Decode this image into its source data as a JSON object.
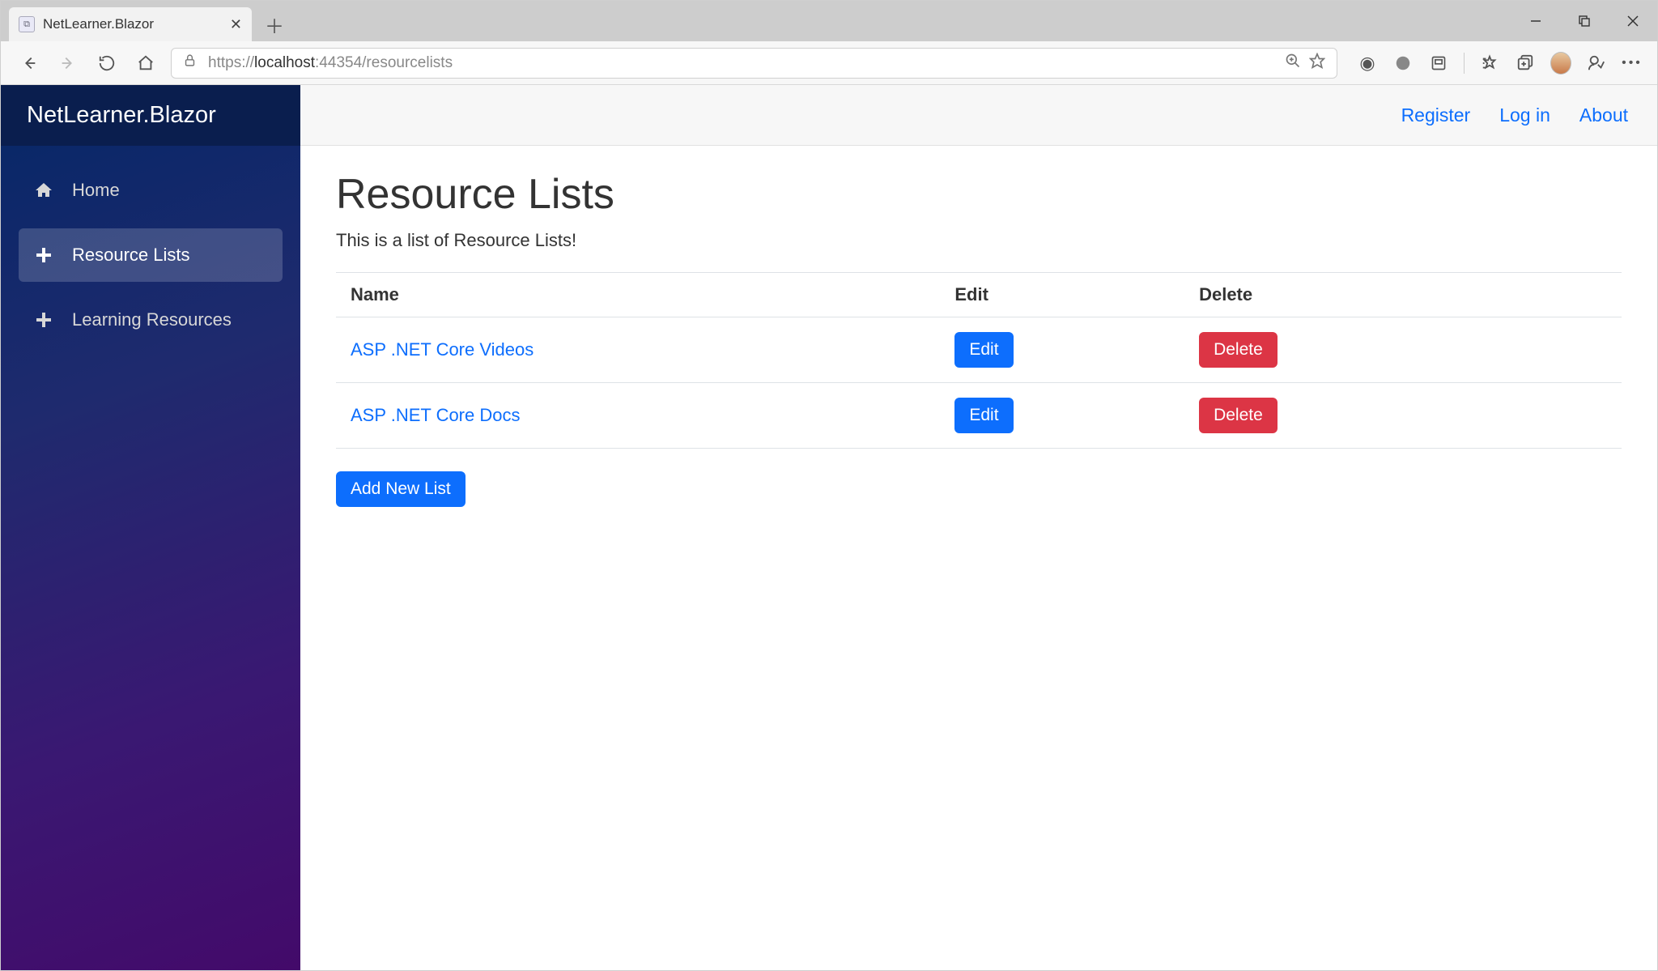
{
  "browser": {
    "tab_title": "NetLearner.Blazor",
    "url_scheme": "https://",
    "url_host": "localhost",
    "url_port_path": ":44354/resourcelists"
  },
  "sidebar": {
    "brand": "NetLearner.Blazor",
    "items": [
      {
        "label": "Home",
        "icon": "home",
        "active": false
      },
      {
        "label": "Resource Lists",
        "icon": "plus",
        "active": true
      },
      {
        "label": "Learning Resources",
        "icon": "plus",
        "active": false
      }
    ]
  },
  "topbar": {
    "links": [
      "Register",
      "Log in",
      "About"
    ]
  },
  "page": {
    "title": "Resource Lists",
    "description": "This is a list of Resource Lists!",
    "columns": {
      "name": "Name",
      "edit": "Edit",
      "delete": "Delete"
    },
    "rows": [
      {
        "name": "ASP .NET Core Videos",
        "edit_label": "Edit",
        "delete_label": "Delete"
      },
      {
        "name": "ASP .NET Core Docs",
        "edit_label": "Edit",
        "delete_label": "Delete"
      }
    ],
    "add_button": "Add New List"
  }
}
